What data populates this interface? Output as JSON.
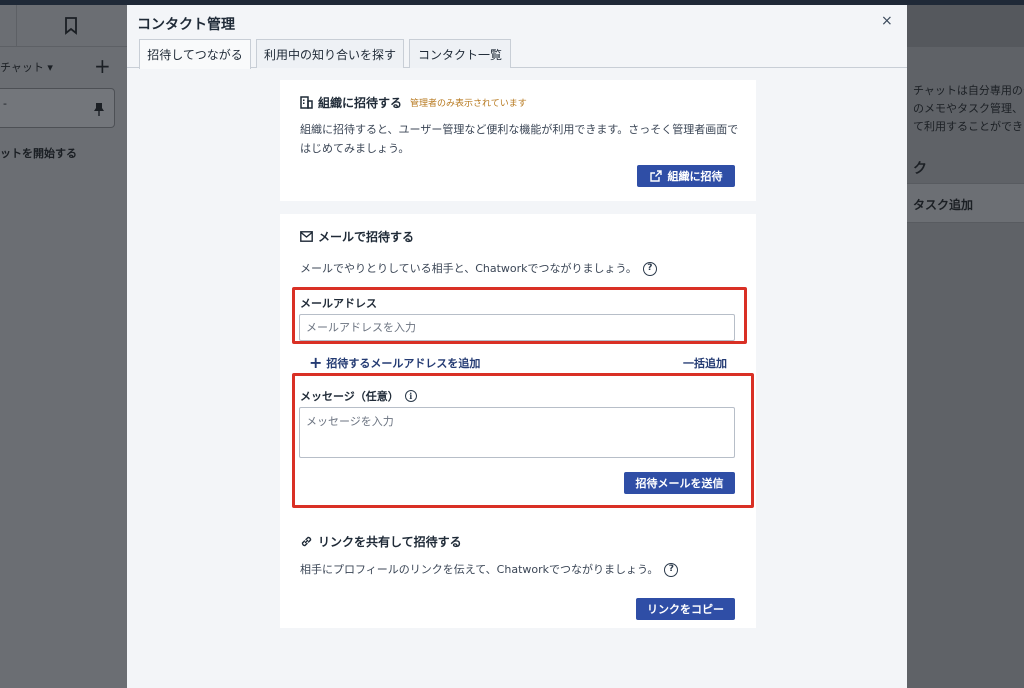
{
  "background": {
    "chat_filter_label": "チャット ▾",
    "room_dash": "‐",
    "start_chat_label": "ットを開始する",
    "description_lines": [
      "チャットは自分専用のチ",
      "のメモやタスク管理、フ",
      "て利用することができま"
    ],
    "section_label": "ク",
    "task_add_label": "タスク追加"
  },
  "modal": {
    "title": "コンタクト管理",
    "close_symbol": "×",
    "tabs": [
      {
        "label": "招待してつながる",
        "active": true
      },
      {
        "label": "利用中の知り合いを探す",
        "active": false
      },
      {
        "label": "コンタクト一覧",
        "active": false
      }
    ]
  },
  "org_invite": {
    "title": "組織に招待する",
    "admin_note": "管理者のみ表示されています",
    "body": "組織に招待すると、ユーザー管理など便利な機能が利用できます。さっそく管理者画面ではじめてみましょう。",
    "button_label": "組織に招待"
  },
  "email_invite": {
    "title": "メールで招待する",
    "body": "メールでやりとりしている相手と、Chatworkでつながりましょう。",
    "help_symbol": "?",
    "email_label": "メールアドレス",
    "email_placeholder": "メールアドレスを入力",
    "email_value": "",
    "add_email_label": "招待するメールアドレスを追加",
    "bulk_add_label": "一括追加",
    "message_label": "メッセージ（任意）",
    "info_symbol": "i",
    "message_placeholder": "メッセージを入力",
    "message_value": "",
    "send_button_label": "招待メールを送信"
  },
  "link_invite": {
    "title": "リンクを共有して招待する",
    "body": "相手にプロフィールのリンクを伝えて、Chatworkでつながりましょう。",
    "help_symbol": "?",
    "button_label": "リンクをコピー"
  },
  "colors": {
    "primary_button": "#2f4ea6",
    "highlight_box": "#d93025",
    "admin_note": "#b7791f"
  }
}
